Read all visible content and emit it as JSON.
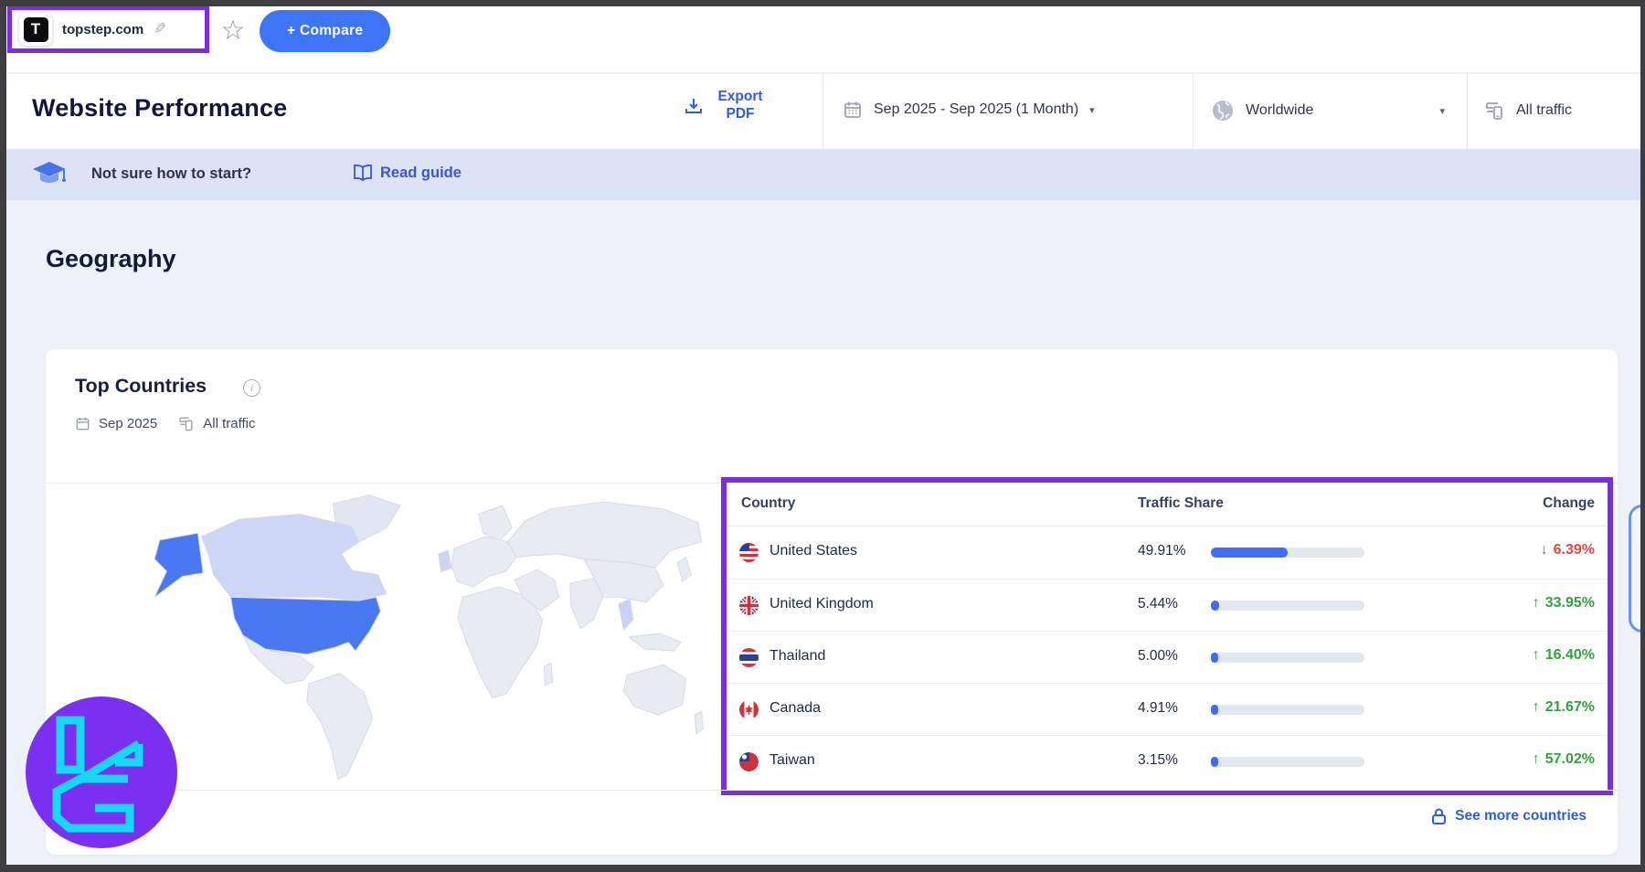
{
  "top_bar": {
    "site_logo_letter": "T",
    "domain": "topstep.com",
    "compare_button": "+  Compare"
  },
  "header": {
    "title": "Website Performance",
    "export_pdf": "Export PDF",
    "date_range": "Sep 2025 - Sep 2025 (1 Month)",
    "region": "Worldwide",
    "traffic_type": "All traffic"
  },
  "banner": {
    "text": "Not sure how to start?",
    "link": "Read guide"
  },
  "geography": {
    "section_title": "Geography",
    "card_title": "Top Countries",
    "meta_date": "Sep 2025",
    "meta_traffic": "All traffic",
    "see_more": "See more countries"
  },
  "table": {
    "columns": [
      "Country",
      "Traffic Share",
      "Change"
    ],
    "rows": [
      {
        "country": "United States",
        "share": "49.91%",
        "share_value": 49.91,
        "change": "6.39%",
        "direction": "down"
      },
      {
        "country": "United Kingdom",
        "share": "5.44%",
        "share_value": 5.44,
        "change": "33.95%",
        "direction": "up"
      },
      {
        "country": "Thailand",
        "share": "5.00%",
        "share_value": 5.0,
        "change": "16.40%",
        "direction": "up"
      },
      {
        "country": "Canada",
        "share": "4.91%",
        "share_value": 4.91,
        "change": "21.67%",
        "direction": "up"
      },
      {
        "country": "Taiwan",
        "share": "3.15%",
        "share_value": 3.15,
        "change": "57.02%",
        "direction": "up"
      }
    ]
  },
  "icons": {
    "arrow_up": "↑",
    "arrow_down": "↓",
    "star": "☆",
    "pencil": "✎",
    "caret_down": "▾",
    "info": "i"
  },
  "colors": {
    "accent_blue": "#3e74f6",
    "link_blue": "#2e5ce6",
    "positive_green": "#2fa53c",
    "negative_red": "#e5483d",
    "annotation_purple": "#7a2ee2",
    "map_highlight": "#4a78f2",
    "map_highlight_light": "#cdd7f5",
    "banner_bg": "#dce3f7",
    "page_bg": "#eef1f7",
    "bar_blue": "#3d6ef5"
  }
}
